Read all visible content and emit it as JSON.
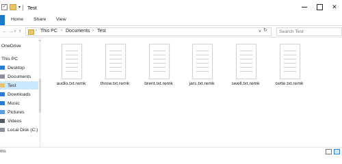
{
  "window": {
    "title": "Test",
    "check_glyph": "✓",
    "minimize_icon": "minimize-icon",
    "maximize_icon": "maximize-icon",
    "close_glyph": "✕"
  },
  "ribbon": {
    "tabs": [
      "Home",
      "Share",
      "View"
    ]
  },
  "address": {
    "back_glyph": "←",
    "forward_glyph": "→",
    "recent_glyph": "∨",
    "up_glyph": "↑",
    "sep_glyph": "›",
    "crumbs": [
      "This PC",
      "Documents",
      "Test"
    ],
    "dropdown_glyph": "∨",
    "refresh_glyph": "↻",
    "search_placeholder": "Search Test"
  },
  "sidebar": {
    "items": [
      {
        "label": "OneDrive",
        "icon": "onedrive-icon",
        "color": "#ffffff"
      },
      {
        "label": "This PC",
        "icon": "pc-icon",
        "color": "#ffffff"
      },
      {
        "label": "Desktop",
        "icon": "desktop-icon",
        "color": "#2b7bd6"
      },
      {
        "label": "Documents",
        "icon": "documents-icon",
        "color": "#8a8f99"
      },
      {
        "label": "Test",
        "icon": "folder-icon",
        "color": "#e9c46a",
        "selected": true
      },
      {
        "label": "Downloads",
        "icon": "downloads-icon",
        "color": "#2b7bd6"
      },
      {
        "label": "Music",
        "icon": "music-icon",
        "color": "#2b7bd6"
      },
      {
        "label": "Pictures",
        "icon": "pictures-icon",
        "color": "#5a9bd8"
      },
      {
        "label": "Videos",
        "icon": "videos-icon",
        "color": "#555a63"
      },
      {
        "label": "Local Disk (C:)",
        "icon": "drive-icon",
        "color": "#8a8f99"
      }
    ]
  },
  "files": [
    {
      "name": "audio.txt.remk"
    },
    {
      "name": "throw.txt.remk"
    },
    {
      "name": "brent.txt.remk"
    },
    {
      "name": "jars.txt.remk"
    },
    {
      "name": "swell.txt.remk"
    },
    {
      "name": "cette.txt.remk"
    }
  ],
  "status": {
    "text": "ms"
  },
  "colors": {
    "accent": "#1979ca",
    "selection": "#cce8ff"
  }
}
